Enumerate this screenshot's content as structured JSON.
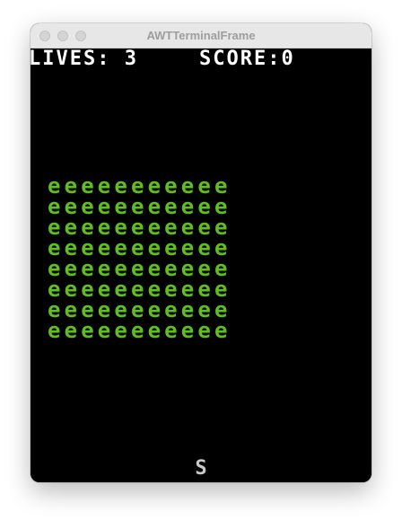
{
  "window": {
    "title": "AWTTerminalFrame"
  },
  "hud": {
    "lives_text": "LIVES: 3",
    "score_text": "SCORE:0"
  },
  "aliens": {
    "glyph": "e",
    "rows": 8,
    "cols": 11,
    "color": "#5fbf1f"
  },
  "player": {
    "glyph": "S"
  },
  "colors": {
    "background": "#000000",
    "hud_text": "#ffffff",
    "alien": "#5fbf1f",
    "player": "#c8c8c8"
  }
}
